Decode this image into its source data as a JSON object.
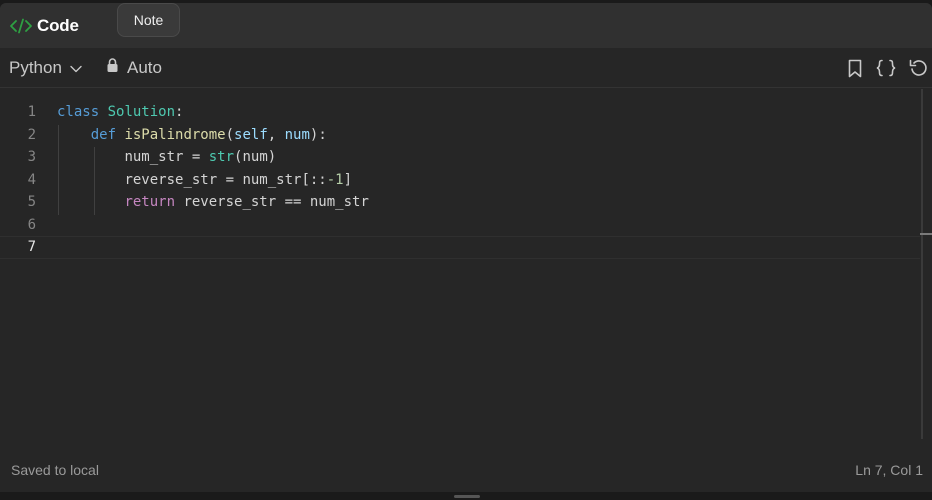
{
  "tabs": {
    "code_label": "Code",
    "note_label": "Note"
  },
  "toolbar": {
    "language": "Python",
    "mode": "Auto"
  },
  "editor": {
    "line_numbers": [
      "1",
      "2",
      "3",
      "4",
      "5",
      "6",
      "7"
    ],
    "current_line": 7,
    "tokens": {
      "l1_class": "class",
      "l1_name": "Solution",
      "l1_colon": ":",
      "l2_def": "def",
      "l2_fn": "isPalindrome",
      "l2_open": "(",
      "l2_self": "self",
      "l2_comma": ", ",
      "l2_num": "num",
      "l2_close": "):",
      "l3_var": "num_str",
      "l3_eq": " = ",
      "l3_fn": "str",
      "l3_args": "(num)",
      "l4_var": "reverse_str",
      "l4_eq": " = ",
      "l4_src": "num_str[::",
      "l4_neg": "-1",
      "l4_end": "]",
      "l5_ret": "return",
      "l5_expr": " reverse_str == num_str"
    }
  },
  "status": {
    "saved": "Saved to local",
    "position": "Ln 7, Col 1"
  },
  "colors": {
    "accent_green": "#2ea043",
    "background": "#262626"
  },
  "icons": {
    "code": "code-brackets-icon",
    "chevron": "chevron-down-icon",
    "lock": "lock-icon",
    "bookmark": "bookmark-icon",
    "braces": "braces-icon",
    "reset": "undo-icon"
  }
}
